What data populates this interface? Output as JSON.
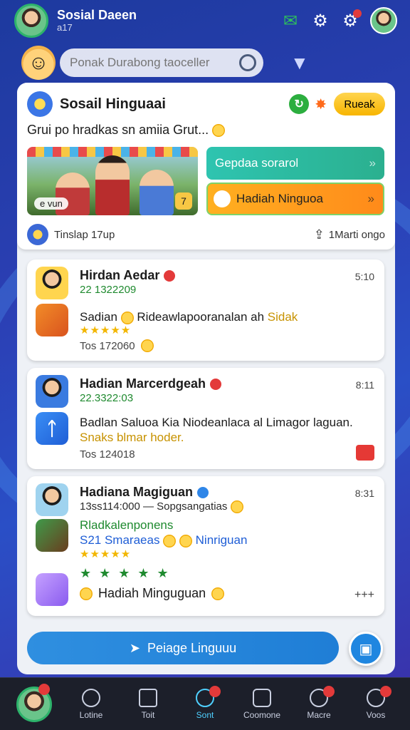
{
  "header": {
    "app_title": "Sosial Daeen",
    "app_subtitle": "a17"
  },
  "search": {
    "placeholder": "Ponak Durabong taoceller"
  },
  "hero": {
    "title": "Sosail Hinguaai",
    "button": "Rueak",
    "text": "Grui po hradkas sn amiia Grut...",
    "image_label": "e vun",
    "image_badge": "7",
    "promo_top": "Gepdaa sorarol",
    "promo_bottom": "Hadiah Ninguoa",
    "footer_left": "Tinslap 17up",
    "footer_right": "1Marti ongo"
  },
  "posts": [
    {
      "name": "Hirdan Aedar",
      "time": "5:10",
      "meta": "22 1322209",
      "body_a": "Sadian",
      "body_b": "Rideawlapooranalan ah",
      "body_hl": "Sidak",
      "stars": "★★★★★",
      "footer": "Tos 172060"
    },
    {
      "name": "Hadian Marcerdgeah",
      "time": "8:11",
      "meta": "22.3322:03",
      "body_a": "Badlan Saluoa Kia Niodeanlaca al Limagor laguan.",
      "body_hl": "Snaks blmar hoder.",
      "icon_glyph": "ᛏ",
      "footer": "Tos 124018"
    },
    {
      "name": "Hadiana Magiguan",
      "time": "8:31",
      "meta": "13ss114:000 — Sopgsangatias",
      "line1": "Rladkalenponens",
      "line2_a": "S21 Smaraeas",
      "line2_b": "Ninriguan",
      "stars": "★★★★★",
      "extra": "★ ★ ★ ★ ★",
      "bottom": "Hadiah Minguguan",
      "more": "+++"
    }
  ],
  "action": {
    "label": "Peiage Linguuu"
  },
  "nav": [
    {
      "label": ""
    },
    {
      "label": "Lotine"
    },
    {
      "label": "Toit"
    },
    {
      "label": "Sont"
    },
    {
      "label": "Coomone"
    },
    {
      "label": "Macre"
    },
    {
      "label": "Voos"
    }
  ],
  "colors": {
    "accent": "#1f86e0",
    "active_nav": "#4fd0ff",
    "badge": "#e33a3a"
  }
}
